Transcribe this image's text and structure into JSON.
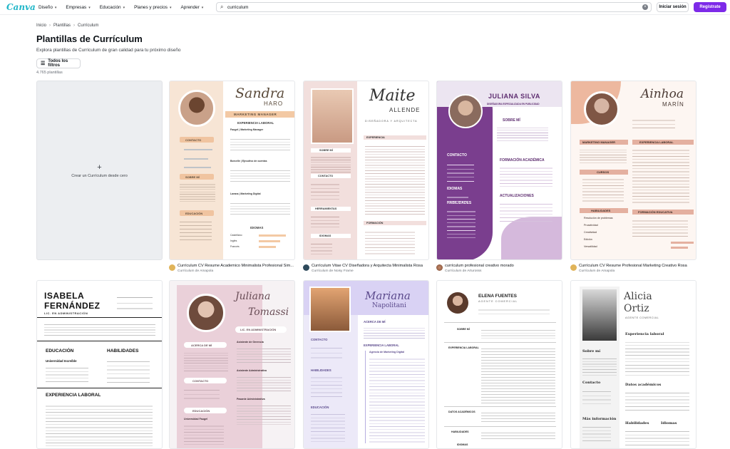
{
  "nav": {
    "logo": "Canva",
    "menu": [
      {
        "label": "Diseño"
      },
      {
        "label": "Empresas"
      },
      {
        "label": "Educación"
      },
      {
        "label": "Planes y precios"
      },
      {
        "label": "Aprender"
      }
    ],
    "search_value": "curriculum",
    "login": "Iniciar sesión",
    "register": "Regístrate"
  },
  "breadcrumb": [
    "Inicio",
    "Plantillas",
    "Currículum"
  ],
  "page": {
    "title": "Plantillas de Currículum",
    "subtitle": "Explora plantillas de Currículum de gran calidad para tu próximo diseño",
    "filters": "Todos los filtros",
    "count": "4.765 plantillas",
    "create": "Crear un Currículum desde cero"
  },
  "colors": {
    "brand": "#7d2ae8",
    "logo": "#1fb6c8",
    "peach": "#f3c9a4",
    "rose": "#e9c9c9",
    "purple": "#7a3e8e",
    "lavender": "#d9d2f4"
  },
  "templates": [
    {
      "title": "Currículum CV Resume Academico Minimalista Profesional Sim...",
      "author": "Currículum de Amapola",
      "name_script": "Sandra",
      "name_caps": "HARO",
      "role": "MARKETING MANAGER",
      "sections": [
        "CONTACTO",
        "SOBRE MÍ",
        "EDUCACIÓN",
        "EXPERIENCIA LABORAL",
        "IDIOMAS"
      ],
      "jobs": [
        "Faugel | Marketing Manager",
        "Borcelle | Ejecutivo de cuentas",
        "Larana | Marketing Digital"
      ],
      "langs": [
        "Castellano",
        "Inglés",
        "Francés"
      ]
    },
    {
      "title": "Currículum Vitae CV Diseñadora y Arquitecta Minimalista Rosa",
      "author": "Currículum de Noisy Frame",
      "name_script": "Maite",
      "name_caps": "ALLENDE",
      "role": "DISEÑADORA Y ARQUITECTA",
      "sections": [
        "SOBRE MÍ",
        "CONTACTO",
        "HERRAMIENTAS",
        "IDIOMAS",
        "EXPERIENCIA",
        "FORMACIÓN"
      ]
    },
    {
      "title": "currículum profesional creativo morado",
      "author": "Currículum de Arturosss",
      "name": "JULIANA SILVA",
      "role": "DISEÑADORA ESPECIALIZADA EN PUBLICIDAD",
      "sections": [
        "SOBRE MÍ",
        "CONTACTO",
        "FORMACIÓN ACADÉMICA",
        "IDIOMAS",
        "HABILIDADES",
        "ACTUALIZACIONES"
      ]
    },
    {
      "title": "Currículum CV Resume Profesional Marketing Creativo Rosa",
      "author": "Currículum de Amapola",
      "name_script": "Ainhoa",
      "name_caps": "MARÍN",
      "sections": [
        "MARKETING MANAGER",
        "EXPERIENCIA LABORAL",
        "CURSOS",
        "HABILIDADES",
        "FORMACIÓN EDUCATIVA"
      ],
      "skills": [
        "Resolución de problemas",
        "Proactividad",
        "Creatividad",
        "Edición",
        "Versatilidad"
      ]
    },
    {
      "name_first": "ISABELA",
      "name_last": "FERNÁNDEZ",
      "role": "LIC. EN ADMINISTRACIÓN",
      "sections": [
        "EDUCACIÓN",
        "HABILIDADES",
        "EXPERIENCIA LABORAL"
      ],
      "school": "Universidad Increíble"
    },
    {
      "name_script": "Juliana",
      "name_caps": "Tomassi",
      "role": "LIC. EN ADMINISTRACIÓN",
      "sections": [
        "ACERCA DE MÍ",
        "CONTACTO",
        "EDUCACIÓN"
      ],
      "jobs": [
        "Asistente de Gerencia",
        "Asistente Administrativa",
        "Pasante Administrativa"
      ],
      "school": "Universidad Faugel"
    },
    {
      "name_script": "Mariana",
      "name_caps": "Napolitani",
      "sections": [
        "ACERCA DE MÍ",
        "CONTACTO",
        "HABILIDADES",
        "EDUCACIÓN",
        "EXPERIENCIA LABORAL"
      ],
      "jobs": [
        "Agencia de Marketing Digital"
      ]
    },
    {
      "name": "ELENA FUENTES",
      "role": "AGENTE COMERCIAL",
      "sections": [
        "SOBRE MÍ",
        "EXPERIENCIA LABORAL",
        "DATOS ACADÉMICOS",
        "HABILIDADES",
        "IDIOMAS"
      ]
    },
    {
      "name_script": "Alicia",
      "name_caps": "Ortiz",
      "role": "AGENTE COMERCIAL",
      "sections": [
        "Experiencia laboral",
        "Sobre mí",
        "Datos académicos",
        "Contacto",
        "Más información",
        "Habilidades",
        "Idiomas"
      ]
    }
  ]
}
